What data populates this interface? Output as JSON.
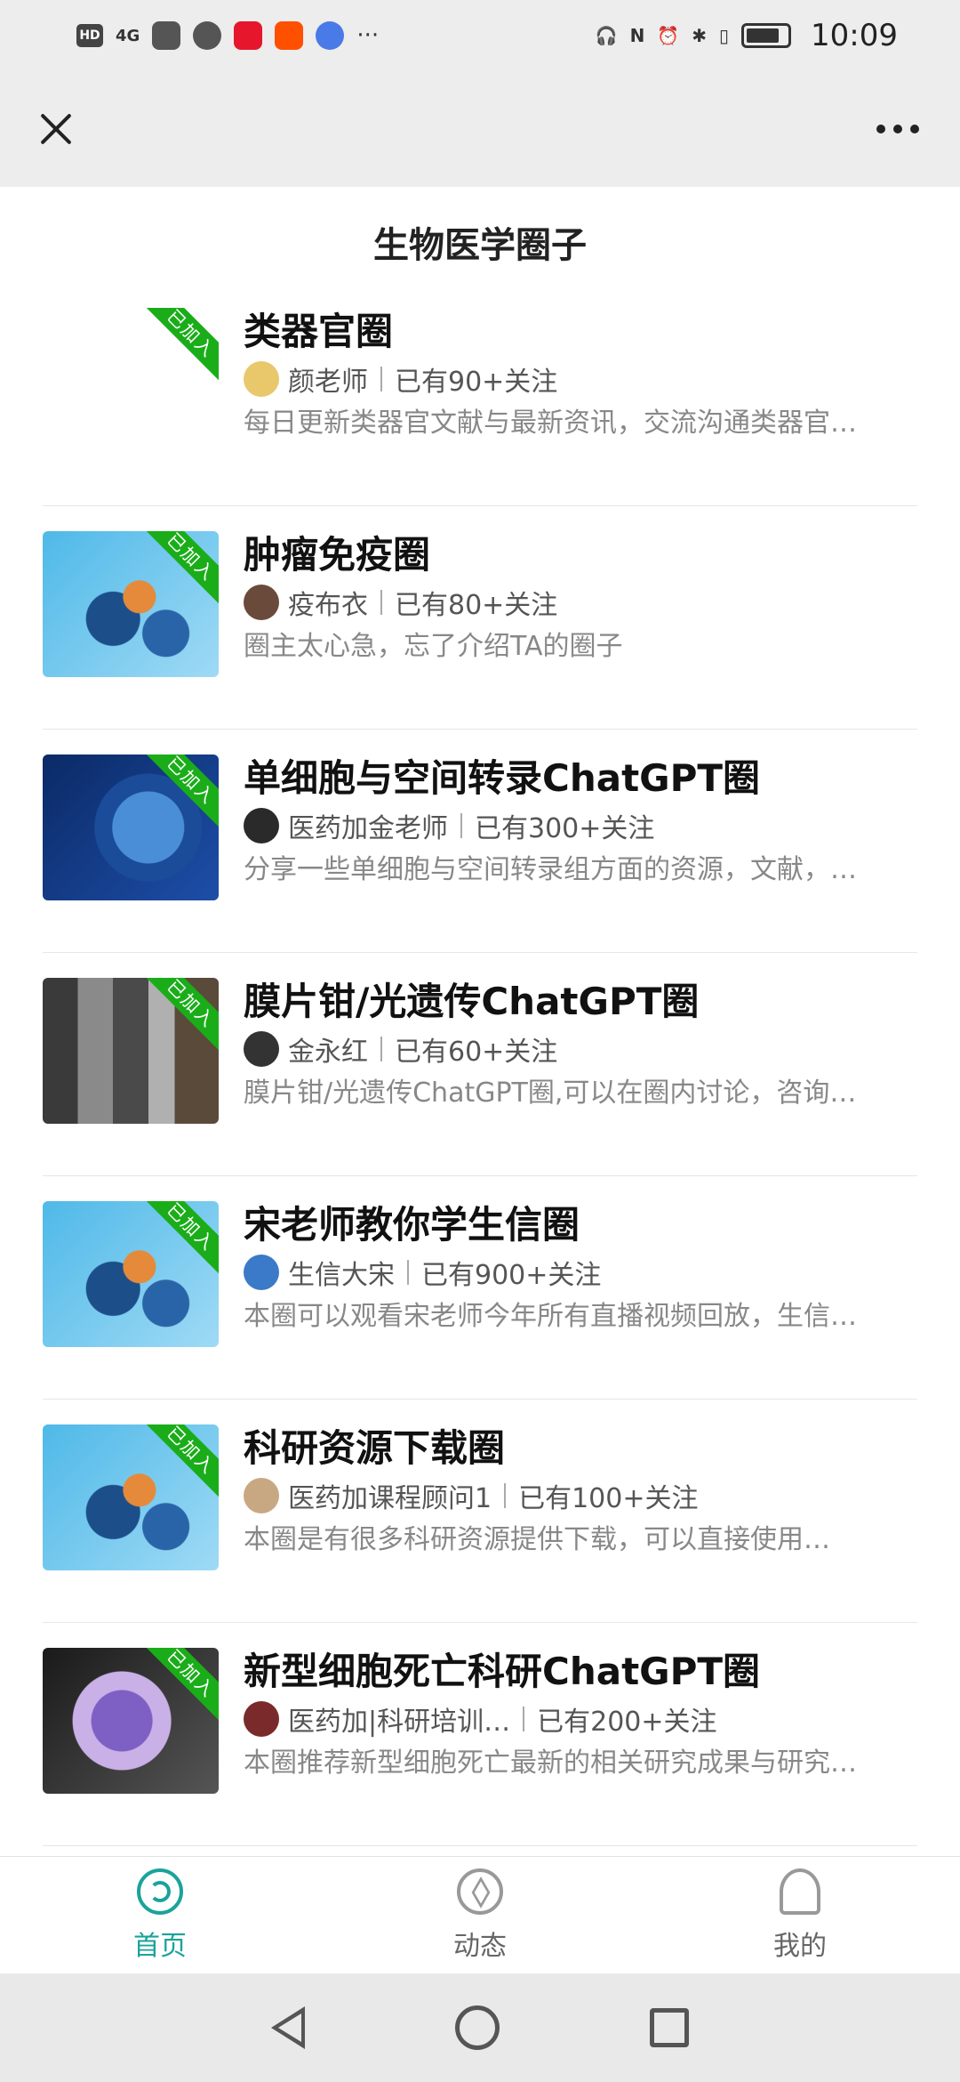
{
  "status_bar": {
    "time": "10:09",
    "left_icons": [
      "hd-icon",
      "signal-4g-icon",
      "wechat-work-icon",
      "message-icon",
      "weibo-icon",
      "taobao-icon",
      "music-icon",
      "more-dots-icon"
    ],
    "hd_label": "HD",
    "signal_label": "4G",
    "overflow_label": "···",
    "right_icons": [
      "headphones-icon",
      "nfc-icon",
      "alarm-icon",
      "bluetooth-icon",
      "vibrate-icon",
      "battery-icon"
    ]
  },
  "topbar": {
    "close_icon": "close-icon",
    "more_icon": "more-dots-icon"
  },
  "page": {
    "title": "生物医学圈子"
  },
  "circles": [
    {
      "name": "类器官圈",
      "owner": "颜老师",
      "followers": "已有90+关注",
      "desc": "每日更新类器官文献与最新资讯，交流沟通类器官…",
      "badge": "已加入",
      "thumb": "organoid",
      "avatar_color": "#e8c86a"
    },
    {
      "name": "肿瘤免疫圈",
      "owner": "疫布衣",
      "followers": "已有80+关注",
      "desc": "圈主太心急，忘了介绍TA的圈子",
      "badge": "已加入",
      "thumb": "protein",
      "avatar_color": "#6a4a3a"
    },
    {
      "name": "单细胞与空间转录ChatGPT圈",
      "owner": "医药加金老师",
      "followers": "已有300+关注",
      "desc": "分享一些单细胞与空间转录组方面的资源，文献，…",
      "badge": "已加入",
      "thumb": "cell",
      "avatar_color": "#2a2a2a"
    },
    {
      "name": "膜片钳/光遗传ChatGPT圈",
      "owner": "金永红",
      "followers": "已有60+关注",
      "desc": "膜片钳/光遗传ChatGPT圈,可以在圈内讨论，咨询…",
      "badge": "已加入",
      "thumb": "lab",
      "avatar_color": "#333333"
    },
    {
      "name": "宋老师教你学生信圈",
      "owner": "生信大宋",
      "followers": "已有900+关注",
      "desc": "本圈可以观看宋老师今年所有直播视频回放，生信…",
      "badge": "已加入",
      "thumb": "protein",
      "avatar_color": "#3a7ac8"
    },
    {
      "name": "科研资源下载圈",
      "owner": "医药加课程顾问1",
      "followers": "已有100+关注",
      "desc": "本圈是有很多科研资源提供下载，可以直接使用…",
      "badge": "已加入",
      "thumb": "protein",
      "avatar_color": "#c8a882"
    },
    {
      "name": "新型细胞死亡科研ChatGPT圈",
      "owner": "医药加|科研培训…",
      "followers": "已有200+关注",
      "desc": "本圈推荐新型细胞死亡最新的相关研究成果与研究…",
      "badge": "已加入",
      "thumb": "death",
      "avatar_color": "#7a2a2a"
    }
  ],
  "bottom_nav": [
    {
      "label": "首页",
      "icon": "home-icon",
      "active": true
    },
    {
      "label": "动态",
      "icon": "compass-icon",
      "active": false
    },
    {
      "label": "我的",
      "icon": "person-icon",
      "active": false
    }
  ],
  "system_nav": [
    "back-triangle-icon",
    "home-circle-icon",
    "recent-square-icon"
  ],
  "colors": {
    "accent": "#1aa39a",
    "badge": "#1aad19",
    "topbar_bg": "#ededed"
  }
}
